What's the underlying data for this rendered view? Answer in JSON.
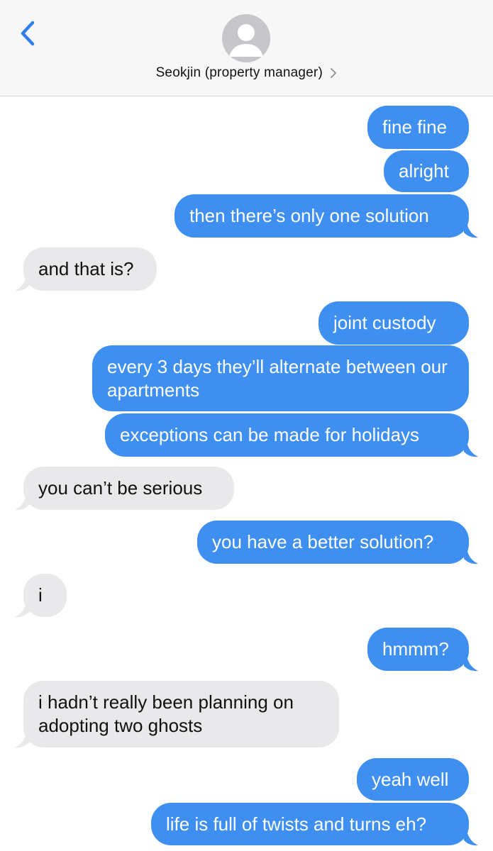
{
  "header": {
    "back_icon": "chevron-left-icon",
    "contact_name": "Seokjin (property manager)",
    "chevron_icon": "chevron-right-icon",
    "avatar_icon": "person-silhouette-icon"
  },
  "colors": {
    "sent_bubble": "#3e8ff0",
    "received_bubble": "#e9e9eb",
    "accent": "#2f7fea",
    "header_bg": "#f7f7f7"
  },
  "messages": [
    {
      "direction": "sent",
      "text": "fine fine"
    },
    {
      "direction": "sent",
      "text": "alright"
    },
    {
      "direction": "sent",
      "text": "then there’s only one solution"
    },
    {
      "direction": "received",
      "text": "and that is?"
    },
    {
      "direction": "sent",
      "text": "joint custody"
    },
    {
      "direction": "sent",
      "text": "every 3 days they’ll alternate between our apartments"
    },
    {
      "direction": "sent",
      "text": "exceptions can be made for holidays"
    },
    {
      "direction": "received",
      "text": "you can’t be serious"
    },
    {
      "direction": "sent",
      "text": "you have a better solution?"
    },
    {
      "direction": "received",
      "text": "i"
    },
    {
      "direction": "sent",
      "text": "hmmm?"
    },
    {
      "direction": "received",
      "text": "i hadn’t really been planning on adopting two ghosts"
    },
    {
      "direction": "sent",
      "text": "yeah well"
    },
    {
      "direction": "sent",
      "text": "life is full of twists and turns eh?"
    }
  ]
}
